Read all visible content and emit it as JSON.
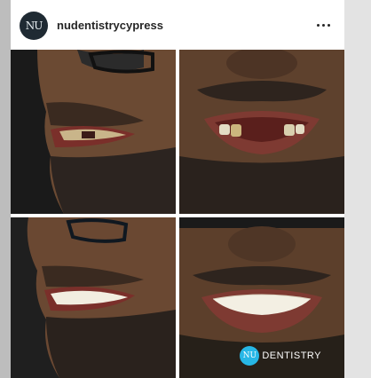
{
  "post": {
    "username": "nudentistrycypress",
    "avatar_text": "NU",
    "more_icon": "more-horizontal-icon"
  },
  "watermark": {
    "logo_text": "NU",
    "text": "DENTISTRY",
    "color": "#27b7e6"
  },
  "photos": [
    {
      "name": "before-side-profile"
    },
    {
      "name": "before-front-smile"
    },
    {
      "name": "after-side-profile"
    },
    {
      "name": "after-front-smile"
    }
  ]
}
